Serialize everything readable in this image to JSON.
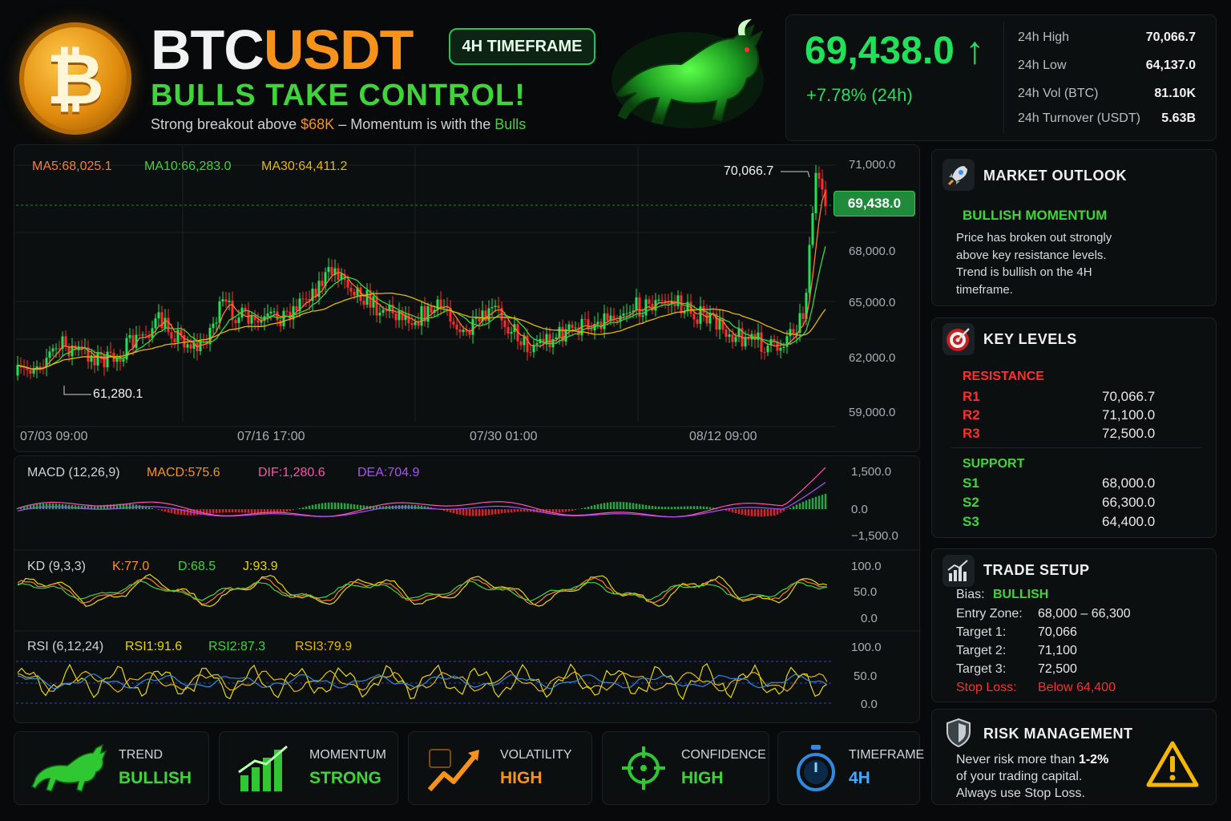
{
  "header": {
    "coin_symbol": "₿",
    "title_a": "BTC",
    "title_b": "USDT",
    "timeframe_badge": "4H TIMEFRAME",
    "subtitle": "BULLS TAKE CONTROL!",
    "tagline_1": "Strong breakout above ",
    "tagline_level": "$68K",
    "tagline_2": " – Momentum is with the ",
    "tagline_bulls": "Bulls"
  },
  "ticker": {
    "price": "69,438.0",
    "arrow": "↑",
    "change": "+7.78% (24h)",
    "stats": [
      {
        "label": "24h High",
        "value": "70,066.7"
      },
      {
        "label": "24h Low",
        "value": "64,137.0"
      },
      {
        "label": "24h Vol (BTC)",
        "value": "81.10K"
      },
      {
        "label": "24h Turnover (USDT)",
        "value": "5.63B"
      }
    ]
  },
  "main_chart": {
    "ma5": "MA5:68,025.1",
    "ma10": "MA10:66,283.0",
    "ma30": "MA30:64,411.2",
    "high_label": "70,066.7",
    "low_label": "61,280.1",
    "current_tag": "69,438.0",
    "y_ticks": [
      "71,000.0",
      "68,000.0",
      "65,000.0",
      "62,000.0",
      "59,000.0"
    ],
    "x_ticks": [
      "07/03 09:00",
      "07/16 17:00",
      "07/30 01:00",
      "08/12 09:00"
    ]
  },
  "macd": {
    "name": "MACD (12,26,9)",
    "macd": "MACD:575.6",
    "dif": "DIF:1,280.6",
    "dea": "DEA:704.9",
    "y_ticks": [
      "1,500.0",
      "0.0",
      "−1,500.0"
    ]
  },
  "kd": {
    "name": "KD (9,3,3)",
    "k": "K:77.0",
    "d": "D:68.5",
    "j": "J:93.9",
    "y_ticks": [
      "100.0",
      "50.0",
      "0.0"
    ]
  },
  "rsi": {
    "name": "RSI (6,12,24)",
    "rsi1": "RSI1:91.6",
    "rsi2": "RSI2:87.3",
    "rsi3": "RSI3:79.9",
    "y_ticks": [
      "100.0",
      "50.0",
      "0.0"
    ]
  },
  "market_outlook": {
    "heading": "MARKET OUTLOOK",
    "status": "BULLISH MOMENTUM",
    "text_1": "Price has broken out strongly",
    "text_2": "above key resistance levels.",
    "text_3": "Trend is bullish on the 4H",
    "text_4": "timeframe."
  },
  "key_levels": {
    "heading": "KEY LEVELS",
    "resistance_label": "RESISTANCE",
    "resistance": [
      {
        "name": "R1",
        "value": "70,066.7"
      },
      {
        "name": "R2",
        "value": "71,100.0"
      },
      {
        "name": "R3",
        "value": "72,500.0"
      }
    ],
    "support_label": "SUPPORT",
    "support": [
      {
        "name": "S1",
        "value": "68,000.0"
      },
      {
        "name": "S2",
        "value": "66,300.0"
      },
      {
        "name": "S3",
        "value": "64,400.0"
      }
    ]
  },
  "trade_setup": {
    "heading": "TRADE SETUP",
    "bias_label": "Bias:",
    "bias_value": "BULLISH",
    "entry_label": "Entry Zone:",
    "entry_value": "68,000 – 66,300",
    "t1_label": "Target 1:",
    "t1_value": "70,066",
    "t2_label": "Target 2:",
    "t2_value": "71,100",
    "t3_label": "Target 3:",
    "t3_value": "72,500",
    "sl_label": "Stop Loss:",
    "sl_value": "Below 64,400"
  },
  "risk": {
    "heading": "RISK MANAGEMENT",
    "line_1a": "Never risk more than ",
    "line_1b": "1-2%",
    "line_2": "of your trading capital.",
    "line_3": "Always use Stop Loss."
  },
  "tiles": [
    {
      "label": "TREND",
      "value": "BULLISH",
      "icon": "bull-icon"
    },
    {
      "label": "MOMENTUM",
      "value": "STRONG",
      "icon": "bar-chart-icon"
    },
    {
      "label": "VOLATILITY",
      "value": "HIGH",
      "icon": "trend-up-icon"
    },
    {
      "label": "CONFIDENCE",
      "value": "HIGH",
      "icon": "crosshair-icon"
    },
    {
      "label": "TIMEFRAME",
      "value": "4H",
      "icon": "stopwatch-icon"
    }
  ],
  "colors": {
    "green": "#21e05a",
    "red": "#ff2d2d",
    "orange": "#f7931a",
    "ma5": "#ff7a2a",
    "ma10": "#3fd43a",
    "ma30": "#e6b800",
    "purple": "#b04cff",
    "magenta": "#ff4fb0"
  }
}
